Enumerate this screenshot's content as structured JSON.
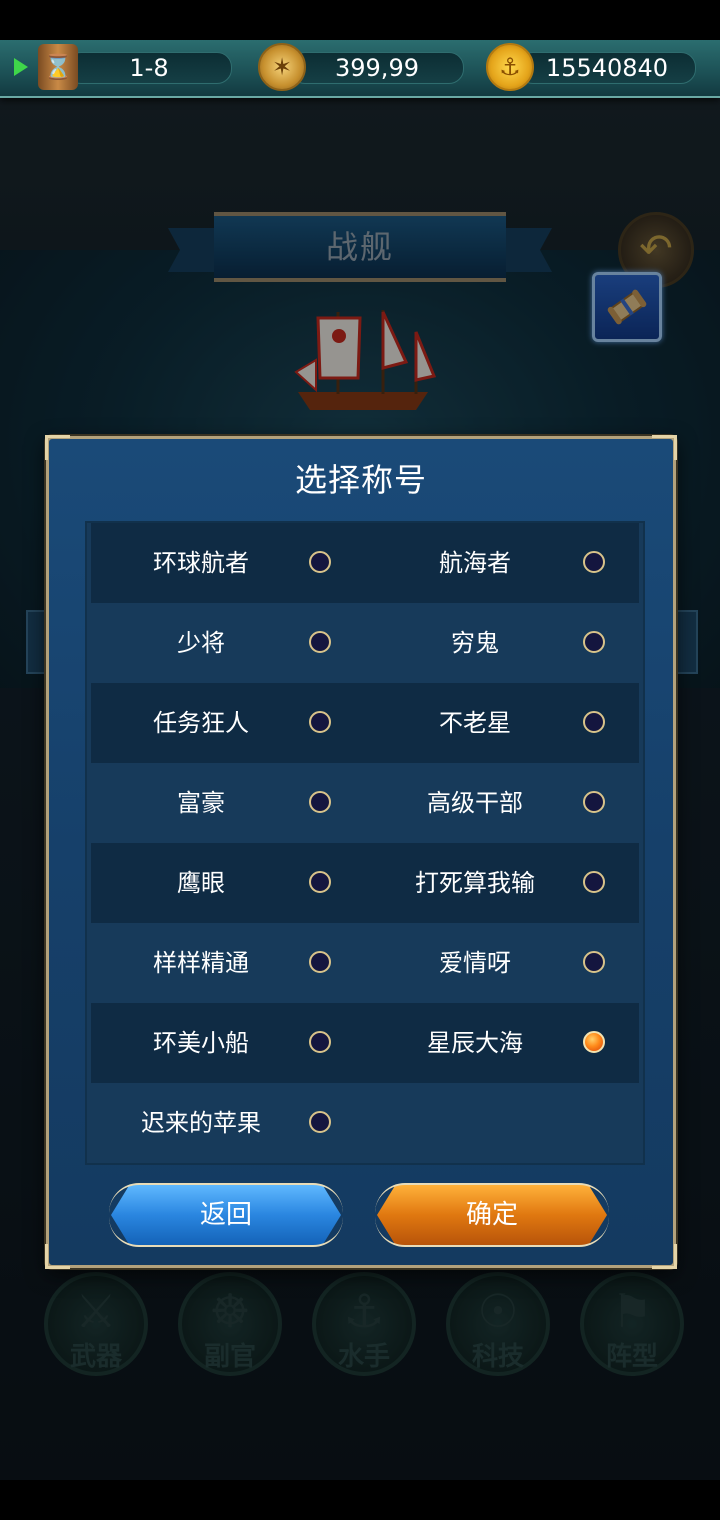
{
  "status_bar": {
    "stage": "1-8",
    "compass_value": "399,99",
    "gold_value": "15540840"
  },
  "page": {
    "banner_title": "战舰"
  },
  "background_menu": [
    {
      "label": "武器",
      "icon": "sword-icon"
    },
    {
      "label": "副官",
      "icon": "helm-wheel-icon"
    },
    {
      "label": "水手",
      "icon": "hook-icon"
    },
    {
      "label": "科技",
      "icon": "compass-icon"
    },
    {
      "label": "阵型",
      "icon": "flag-icon"
    }
  ],
  "dialog": {
    "title": "选择称号",
    "titles": [
      {
        "name": "环球航者",
        "selected": false
      },
      {
        "name": "航海者",
        "selected": false
      },
      {
        "name": "少将",
        "selected": false
      },
      {
        "name": "穷鬼",
        "selected": false
      },
      {
        "name": "任务狂人",
        "selected": false
      },
      {
        "name": "不老星",
        "selected": false
      },
      {
        "name": "富豪",
        "selected": false
      },
      {
        "name": "高级干部",
        "selected": false
      },
      {
        "name": "鹰眼",
        "selected": false
      },
      {
        "name": "打死算我输",
        "selected": false
      },
      {
        "name": "样样精通",
        "selected": false
      },
      {
        "name": "爱情呀",
        "selected": false
      },
      {
        "name": "环美小船",
        "selected": false
      },
      {
        "name": "星辰大海",
        "selected": true
      },
      {
        "name": "迟来的苹果",
        "selected": false
      }
    ],
    "back_label": "返回",
    "confirm_label": "确定"
  },
  "colors": {
    "accent_confirm": "#e07810",
    "accent_back": "#2a86e0",
    "radio_selected": "#ff8a1a",
    "dialog_bg": "#16406a"
  }
}
